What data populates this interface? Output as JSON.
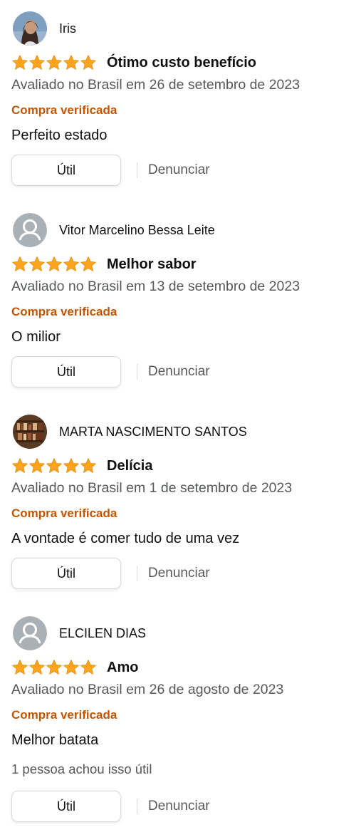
{
  "colors": {
    "star": "#ffa41c",
    "verified": "#c45500",
    "muted_text": "#565959",
    "text": "#0f1111",
    "button_border": "#d5d9d9"
  },
  "reviews": [
    {
      "author": "Iris",
      "avatar": "user-photo-avatar",
      "rating": 5,
      "title": "Ótimo custo benefício",
      "date": "Avaliado no Brasil em 26 de setembro de 2023",
      "verified": "Compra verificada",
      "body": "Perfeito estado",
      "helpful_count": "",
      "helpful_label": "Útil",
      "report_label": "Denunciar"
    },
    {
      "author": "Vitor Marcelino Bessa Leite",
      "avatar": "default-user-avatar-icon",
      "rating": 5,
      "title": "Melhor sabor",
      "date": "Avaliado no Brasil em 13 de setembro de 2023",
      "verified": "Compra verificada",
      "body": "O milior",
      "helpful_count": "",
      "helpful_label": "Útil",
      "report_label": "Denunciar"
    },
    {
      "author": "MARTA NASCIMENTO SANTOS",
      "avatar": "bookshelf-photo-avatar",
      "rating": 5,
      "title": "Delícia",
      "date": "Avaliado no Brasil em 1 de setembro de 2023",
      "verified": "Compra verificada",
      "body": "A vontade é comer tudo de uma vez",
      "helpful_count": "",
      "helpful_label": "Útil",
      "report_label": "Denunciar"
    },
    {
      "author": "ELCILEN DIAS",
      "avatar": "default-user-avatar-icon",
      "rating": 5,
      "title": "Amo",
      "date": "Avaliado no Brasil em 26 de agosto de 2023",
      "verified": "Compra verificada",
      "body": "Melhor batata",
      "helpful_count": "1 pessoa achou isso útil",
      "helpful_label": "Útil",
      "report_label": "Denunciar"
    }
  ]
}
